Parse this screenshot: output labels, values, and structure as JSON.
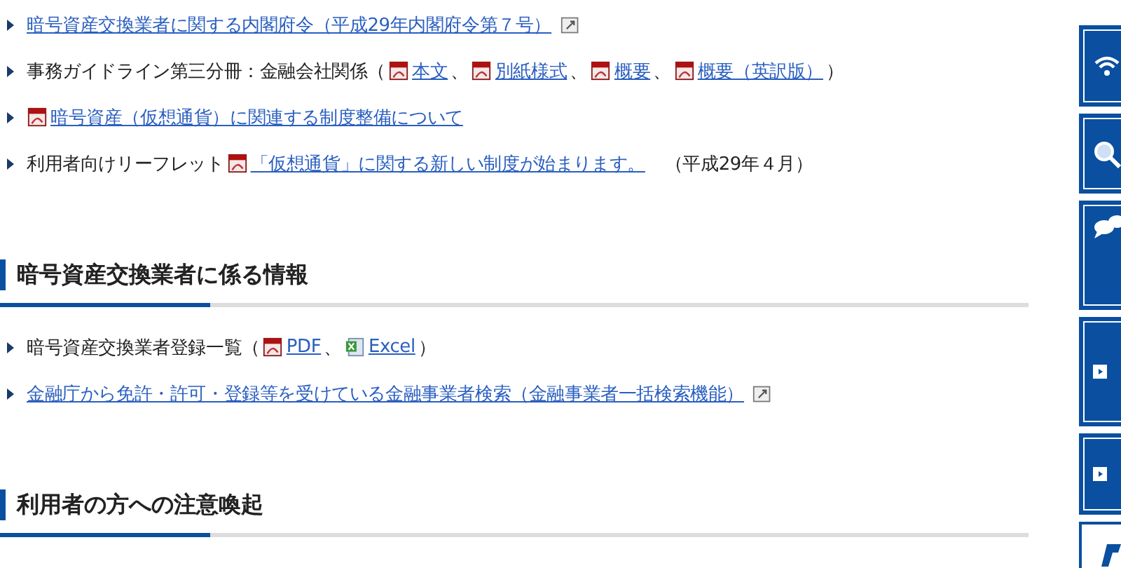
{
  "sections": [
    {
      "items": [
        {
          "segments": [
            {
              "kind": "external-link",
              "text": "暗号資産交換業者に関する内閣府令（平成29年内閣府令第７号）"
            }
          ]
        },
        {
          "segments": [
            {
              "kind": "text",
              "text": "事務ガイドライン第三分冊：金融会社関係（"
            },
            {
              "kind": "pdf-link",
              "text": "本文"
            },
            {
              "kind": "text",
              "text": "、"
            },
            {
              "kind": "pdf-link",
              "text": "別紙様式"
            },
            {
              "kind": "text",
              "text": "、"
            },
            {
              "kind": "pdf-link",
              "text": "概要"
            },
            {
              "kind": "text",
              "text": "、"
            },
            {
              "kind": "pdf-link",
              "text": "概要（英訳版）"
            },
            {
              "kind": "text",
              "text": "）"
            }
          ]
        },
        {
          "segments": [
            {
              "kind": "pdf-link",
              "text": "暗号資産（仮想通貨）に関連する制度整備について"
            }
          ]
        },
        {
          "segments": [
            {
              "kind": "text",
              "text": "利用者向けリーフレット"
            },
            {
              "kind": "pdf-link",
              "text": "「仮想通貨」に関する新しい制度が始まります。"
            },
            {
              "kind": "text",
              "text": "（平成29年４月）"
            }
          ]
        }
      ]
    },
    {
      "heading": "暗号資産交換業者に係る情報",
      "items": [
        {
          "segments": [
            {
              "kind": "text",
              "text": "暗号資産交換業者登録一覧（"
            },
            {
              "kind": "pdf-link",
              "text": "PDF"
            },
            {
              "kind": "text",
              "text": "、"
            },
            {
              "kind": "excel-link",
              "text": "Excel"
            },
            {
              "kind": "text",
              "text": "）"
            }
          ]
        },
        {
          "segments": [
            {
              "kind": "external-link",
              "text": "金融庁から免許・許可・登録等を受けている金融事業者検索（金融事業者一括検索機能）"
            }
          ]
        }
      ]
    },
    {
      "heading": "利用者の方への注意喚起"
    }
  ],
  "side_buttons": [
    {
      "kind": "wifi"
    },
    {
      "kind": "search"
    },
    {
      "kind": "chat"
    },
    {
      "kind": "arrow"
    },
    {
      "kind": "arrow"
    },
    {
      "kind": "logo"
    }
  ]
}
